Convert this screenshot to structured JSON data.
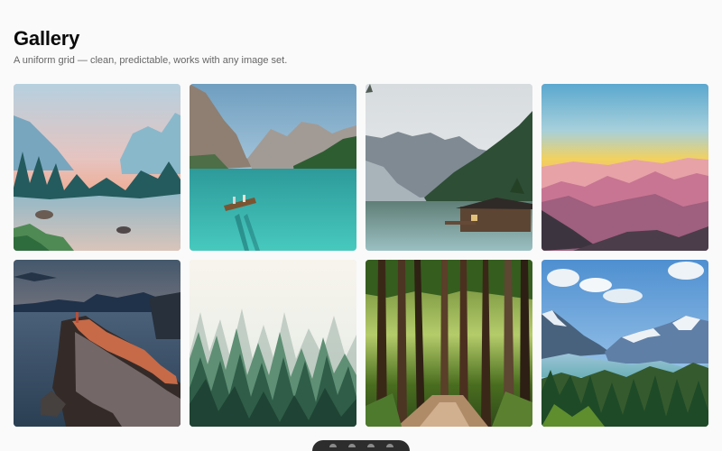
{
  "header": {
    "title": "Gallery",
    "subtitle": "A uniform grid — clean, predictable, works with any image set."
  },
  "gallery": {
    "items": [
      {
        "id": "tile-1",
        "scene": "valley-river-sunset"
      },
      {
        "id": "tile-2",
        "scene": "mountain-lake-boat"
      },
      {
        "id": "tile-3",
        "scene": "misty-mountains-cabin-lake"
      },
      {
        "id": "tile-4",
        "scene": "mountain-layers-sunset"
      },
      {
        "id": "tile-5",
        "scene": "cliff-village-dusk"
      },
      {
        "id": "tile-6",
        "scene": "foggy-pine-forest"
      },
      {
        "id": "tile-7",
        "scene": "forest-path"
      },
      {
        "id": "tile-8",
        "scene": "snowy-peaks-pine-valley"
      }
    ]
  },
  "toolbar": {
    "icons": [
      "dot-icon",
      "dot-icon",
      "menu-icon",
      "window-icon"
    ]
  }
}
